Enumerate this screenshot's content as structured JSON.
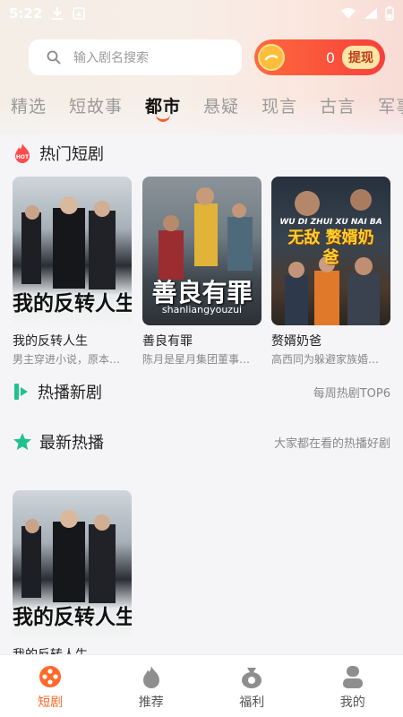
{
  "status_bar": {
    "time": "5:22"
  },
  "search": {
    "placeholder": "输入剧名搜索"
  },
  "coins": {
    "count": "0",
    "withdraw_label": "提现"
  },
  "tabs": [
    {
      "label": "精选"
    },
    {
      "label": "短故事"
    },
    {
      "label": "都市"
    },
    {
      "label": "悬疑"
    },
    {
      "label": "现言"
    },
    {
      "label": "古言"
    },
    {
      "label": "军事"
    }
  ],
  "sections": {
    "hot": {
      "title": "热门短剧"
    },
    "new_broadcast": {
      "title": "热播新剧",
      "subtitle": "每周热剧TOP6"
    },
    "latest": {
      "title": "最新热播",
      "subtitle": "大家都在看的热播好剧"
    }
  },
  "hot_dramas": [
    {
      "title": "我的反转人生",
      "desc": "男主穿进小说，原本…",
      "poster_text": "我的反转人生"
    },
    {
      "title": "善良有罪",
      "desc": "陈月是星月集团董事…",
      "poster_text": "善良有罪",
      "poster_sub": "shanliangyouzui"
    },
    {
      "title": "赘婿奶爸",
      "desc": "高西同为躲避家族婚…",
      "poster_text": "无敌 赘婿奶爸",
      "poster_sub": "WU DI ZHUI XU NAI BA"
    }
  ],
  "latest_dramas": [
    {
      "title": "我的反转人生",
      "poster_text": "我的反转人生"
    }
  ],
  "bottom_nav": [
    {
      "label": "短剧"
    },
    {
      "label": "推荐"
    },
    {
      "label": "福利"
    },
    {
      "label": "我的"
    }
  ],
  "colors": {
    "accent": "#ff6a2a",
    "coin_pill": "#f7403c",
    "section_green": "#1fc38a"
  }
}
